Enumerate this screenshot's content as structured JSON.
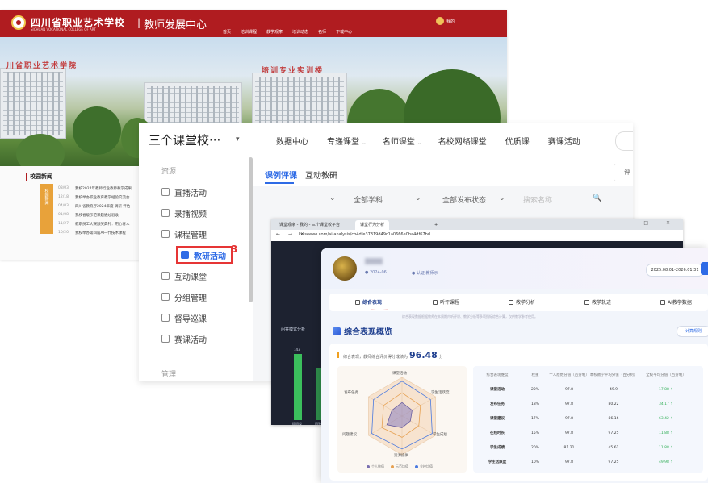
{
  "site": {
    "title": "四川省职业艺术学校",
    "subtitle": "SICHUAN VOCATIONAL COLLEGE OF ART",
    "separator": "|",
    "center": "教师发展中心",
    "nav": [
      "首页",
      "培训课程",
      "教学观摩",
      "培训动态",
      "名师",
      "下载中心"
    ],
    "user": "我的",
    "banner_signs": [
      "川省职业艺术学院",
      "培训专业实训楼"
    ],
    "news_title": "校园新闻",
    "news_image_label": "校园新闻",
    "news": [
      {
        "date": "08/03",
        "text": "我校2024年教师行业教师教学成果"
      },
      {
        "date": "12/18",
        "text": "我校举办职业教育教学经验交流会"
      },
      {
        "date": "04/03",
        "text": "四川省教育厅2024年度 调研 评估"
      },
      {
        "date": "01/08",
        "text": "我校省级示范课题通过验收"
      },
      {
        "date": "11/27",
        "text": "教职员工大赛颁奖典礼：用心育人"
      },
      {
        "date": "10/20",
        "text": "我校举办第四届AI一代技术课程"
      }
    ]
  },
  "platform": {
    "name": "三个课堂校···",
    "caret": "▾",
    "nav": [
      {
        "label": "数据中心",
        "caret": ""
      },
      {
        "label": "专递课堂",
        "caret": "⌄"
      },
      {
        "label": "名师课堂",
        "caret": "⌄"
      },
      {
        "label": "名校网络课堂",
        "caret": ""
      },
      {
        "label": "优质课",
        "caret": ""
      },
      {
        "label": "赛课活动",
        "caret": ""
      }
    ],
    "sidebar_head": "资源",
    "sidebar_footer": "管理",
    "sidebar": [
      {
        "label": "直播活动"
      },
      {
        "label": "录播视频"
      },
      {
        "label": "课程管理"
      },
      {
        "label": "教研活动"
      },
      {
        "label": "互动课堂"
      },
      {
        "label": "分组管理"
      },
      {
        "label": "督导巡课"
      },
      {
        "label": "赛课活动"
      }
    ],
    "step_number": "3",
    "tabs": [
      "课例评课",
      "互动教研"
    ],
    "tab_button": "评",
    "filters": [
      "⌄",
      "全部学科",
      "⌄",
      "全部发布状态",
      "⌄",
      "搜索名称",
      "🔍"
    ]
  },
  "browser": {
    "tabs": [
      "课堂观摩 - 我的 - 三个课堂校平台",
      "课堂行为分析",
      "+"
    ],
    "window_controls": "– □ ✕",
    "nav_buttons": "← → ✕",
    "url": "ke.seewo.com/ai-analysis/cb4dfe37319d49c1a0666e0ba4df67bd",
    "chart_title": "问答模式分析",
    "bar_value": "143",
    "bar_labels": [
      "提问类",
      "回答类"
    ],
    "chart_data": {
      "type": "bar",
      "title": "问答模式分析",
      "categories": [
        "提问类",
        "回答类"
      ],
      "values": [
        143,
        112
      ]
    }
  },
  "report": {
    "name_blurred": "████",
    "meta": [
      "● 2024-06",
      "● 认证 教师示"
    ],
    "date_range": "2025.08.01-2026.01.31",
    "tabs": [
      {
        "icon": "report-icon",
        "label": "综合表现"
      },
      {
        "icon": "lesson-icon",
        "label": "听评课程"
      },
      {
        "icon": "analysis-icon",
        "label": "教学分析"
      },
      {
        "icon": "track-icon",
        "label": "教学轨迹"
      },
      {
        "icon": "ai-icon",
        "label": "AI教学数据"
      }
    ],
    "note": "综合表现数据根据教师在本周期内听评课、教学分析等多项指标综合计算，仅供教学参考使用。",
    "section_title": "综合表现概览",
    "calc_button": "计算规则",
    "score_prefix": "综合表现，教师综合评价得分成绩为",
    "score": "96.48",
    "score_suffix": "分",
    "radar_labels": [
      "课堂活动",
      "学生活跃度",
      "学生成绩",
      "资源提供",
      "问题建议",
      "发布任务"
    ],
    "radar_legend": [
      "个人数值",
      "示范均值",
      "全校均值"
    ],
    "table_header": [
      "综合表现维度",
      "权重",
      "个人原始分值（百分制）",
      "本校教学平均分值（百分制）",
      "全校平均分值（百分制）"
    ],
    "table_rows": [
      [
        "课堂活动",
        "20%",
        "97.8",
        "49.9",
        "17.88 ↑"
      ],
      [
        "发布任务",
        "18%",
        "97.8",
        "80.22",
        "34.17 ↑"
      ],
      [
        "课堂建议",
        "17%",
        "97.8",
        "86.16",
        "63.42 ↑"
      ],
      [
        "在线时长",
        "15%",
        "97.8",
        "97.25",
        "11.88 ↑"
      ],
      [
        "学生成绩",
        "20%",
        "81.21",
        "45.61",
        "11.88 ↑"
      ],
      [
        "学生活跃度",
        "10%",
        "97.8",
        "97.25",
        "49.98 ↑"
      ]
    ],
    "chart_data": {
      "type": "radar",
      "axes": [
        "课堂活动",
        "学生活跃度",
        "学生成绩",
        "资源提供",
        "问题建议",
        "发布任务"
      ],
      "series": [
        {
          "name": "个人数值",
          "values": [
            0.35,
            0.3,
            0.25,
            0.3,
            0.45,
            0.3
          ]
        },
        {
          "name": "示范均值",
          "values": [
            0.6,
            0.55,
            0.5,
            0.55,
            0.6,
            0.55
          ]
        },
        {
          "name": "全校均值",
          "values": [
            0.9,
            0.85,
            0.9,
            0.85,
            0.9,
            0.85
          ]
        }
      ]
    }
  },
  "colors": {
    "site_red": "#b01c20",
    "primary_blue": "#2e6be6",
    "highlight_red": "#e63535",
    "bar_green": "#3bbf5c"
  }
}
